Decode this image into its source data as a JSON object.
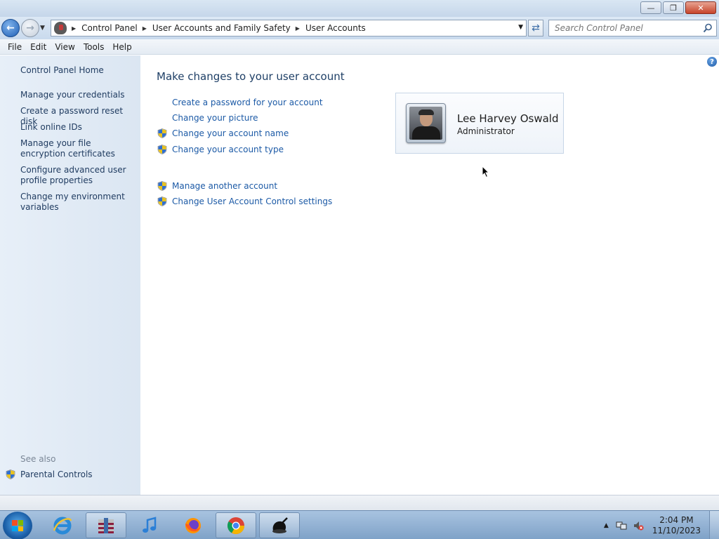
{
  "window": {
    "controls": {
      "minimize": "—",
      "restore": "❐",
      "close": "✕"
    }
  },
  "nav": {
    "breadcrumbs": [
      "Control Panel",
      "User Accounts and Family Safety",
      "User Accounts"
    ],
    "search_placeholder": "Search Control Panel"
  },
  "menu": [
    "File",
    "Edit",
    "View",
    "Tools",
    "Help"
  ],
  "sidebar": {
    "home": "Control Panel Home",
    "links": [
      "Manage your credentials",
      "Create a password reset disk",
      "Link online IDs",
      "Manage your file encryption certificates",
      "Configure advanced user profile properties",
      "Change my environment variables"
    ],
    "see_also_label": "See also",
    "see_also_items": [
      "Parental Controls"
    ]
  },
  "main": {
    "title": "Make changes to your user account",
    "tasks": [
      "Create a password for your account",
      "Change your picture",
      "Change your account name",
      "Change your account type"
    ],
    "other_tasks": [
      "Manage another account",
      "Change User Account Control settings"
    ]
  },
  "account": {
    "name": "Lee Harvey Oswald",
    "type": "Administrator"
  },
  "taskbar": {
    "apps": [
      "internet-explorer-icon",
      "archive-manager-icon",
      "itunes-icon",
      "firefox-icon",
      "chrome-icon",
      "app-icon"
    ],
    "time": "2:04 PM",
    "date": "11/10/2023"
  },
  "colors": {
    "link": "#1c5aa6",
    "sidebar_link": "#1e3a5f",
    "title": "#1e3f66",
    "sidebar_bg": "#dbe6f2"
  }
}
